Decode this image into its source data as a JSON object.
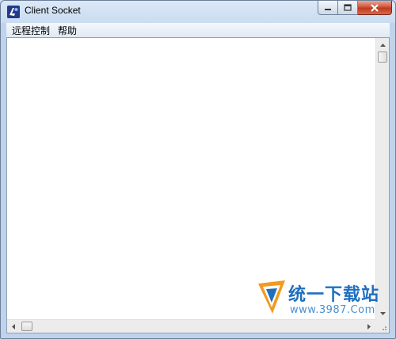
{
  "window": {
    "title": "Client Socket",
    "icon": "app-icon",
    "controls": [
      "minimize-icon",
      "maximize-icon",
      "close-icon"
    ]
  },
  "menubar": {
    "items": [
      {
        "label": "远程控制"
      },
      {
        "label": "帮助"
      }
    ]
  },
  "watermark": {
    "brand": "统一下载站",
    "url": "www.3987.Com"
  },
  "colors": {
    "close_button": "#c74a2c",
    "watermark_blue": "#1f6fc0",
    "watermark_orange": "#f39a1e"
  }
}
